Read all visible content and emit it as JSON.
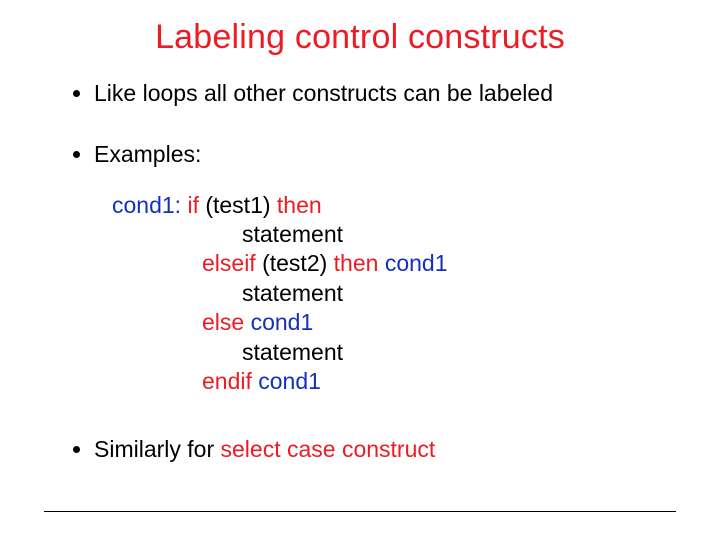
{
  "title": "Labeling control constructs",
  "bullet1": "Like loops all other constructs can be labeled",
  "bullet2": "Examples:",
  "code": {
    "l1": {
      "a": "cond1:",
      "b": " if ",
      "c": "(test1) ",
      "d": "then"
    },
    "l2": "statement",
    "l3": {
      "a": "elseif ",
      "b": "(test2) ",
      "c": "then ",
      "d": "cond1"
    },
    "l4": "statement",
    "l5": {
      "a": "else ",
      "b": "cond1"
    },
    "l6": "statement",
    "l7": {
      "a": "endif ",
      "b": "cond1"
    }
  },
  "bullet3": {
    "a": "Similarly for ",
    "b": "select case construct"
  }
}
